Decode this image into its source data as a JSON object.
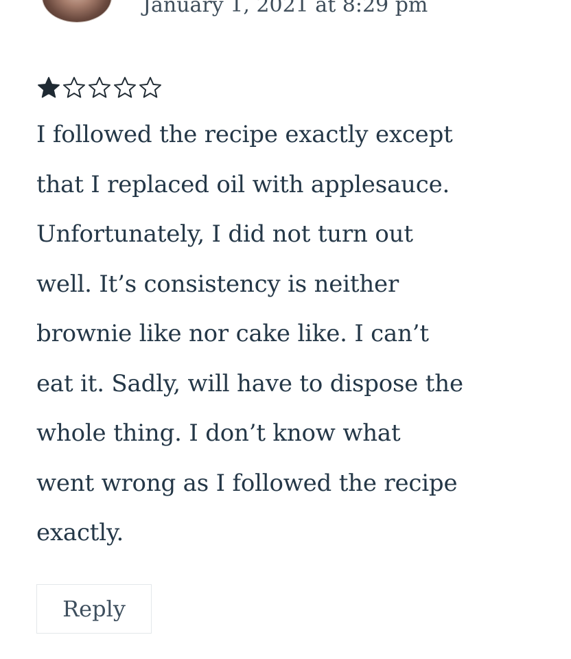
{
  "comment": {
    "date": "January 1, 2021 at 8:29 pm",
    "rating": {
      "value": 1,
      "max": 5
    },
    "text": "I followed the recipe exactly except\nthat I replaced oil with applesauce.\nUnfortunately, I did not turn out\nwell. It’s consistency is neither\nbrownie like nor cake like. I can’t\neat it. Sadly, will have to dispose the\nwhole thing. I don’t know what\nwent wrong as I followed the recipe\nexactly.",
    "reply_label": "Reply"
  },
  "colors": {
    "text": "#243747",
    "star": "#1f2a33"
  }
}
